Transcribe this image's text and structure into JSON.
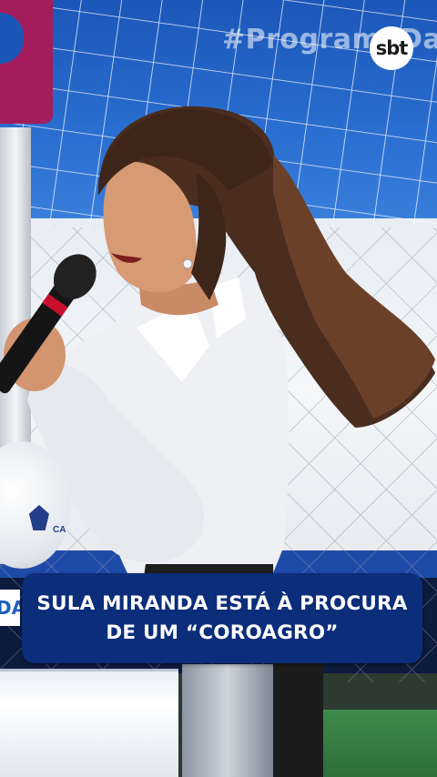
{
  "overlay": {
    "hashtag": "#ProgramaDa",
    "channel_logo": "sbt",
    "side_tag": "DA"
  },
  "ball": {
    "text": "CA"
  },
  "caption": {
    "line1": "SULA MIRANDA ESTÁ À PROCURA",
    "line2": "DE UM “COROAGRO”"
  },
  "colors": {
    "caption_background": "#0b2d7a",
    "backdrop_blue": "#1b57b8",
    "accent_pink": "#a31d5c"
  }
}
